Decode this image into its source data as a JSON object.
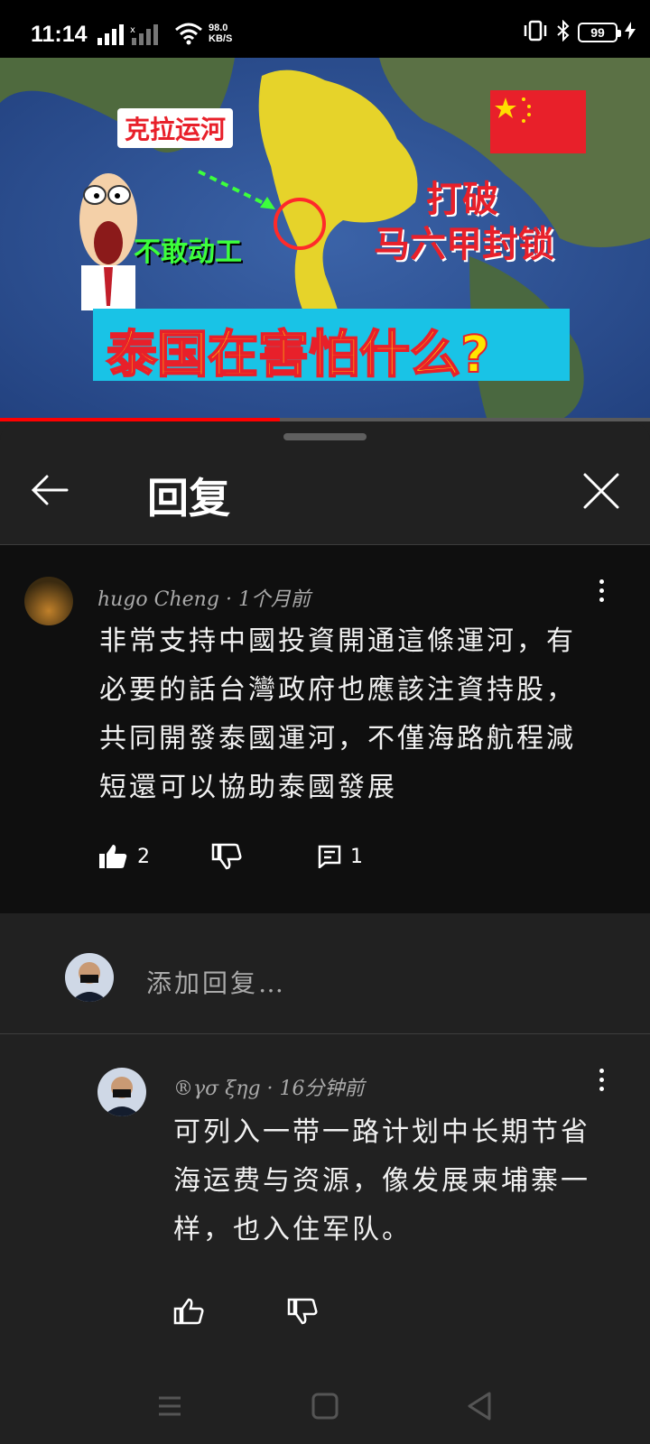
{
  "status_bar": {
    "time": "11:14",
    "net_speed": "98.0",
    "net_unit": "KB/S",
    "battery": "99"
  },
  "video": {
    "label_canal": "克拉运河",
    "label_dare": "不敢动工",
    "label_break_1": "打破",
    "label_break_2": "马六甲封锁",
    "banner": "泰国在害怕什么?",
    "progress": 0.43
  },
  "header": {
    "title": "回复"
  },
  "comments": [
    {
      "author": "hugo Cheng",
      "time": "1个月前",
      "text": "非常支持中國投資開通這條運河，有必要的話台灣政府也應該注資持股，共同開發泰國運河，不僅海路航程減短還可以協助泰國發展",
      "likes": "2",
      "replies": "1"
    }
  ],
  "add_reply": {
    "placeholder": "添加回复…"
  },
  "replies": [
    {
      "author": "®γσ ξηg",
      "time": "16分钟前",
      "text": "可列入一带一路计划中长期节省海运费与资源，像发展柬埔寨一样，也入住军队。"
    }
  ],
  "colors": {
    "background": "#212121",
    "comment_background": "#0f0f0f",
    "progress": "#ff0000",
    "banner_yellow": "#ffe600",
    "banner_red": "#e8202a"
  }
}
